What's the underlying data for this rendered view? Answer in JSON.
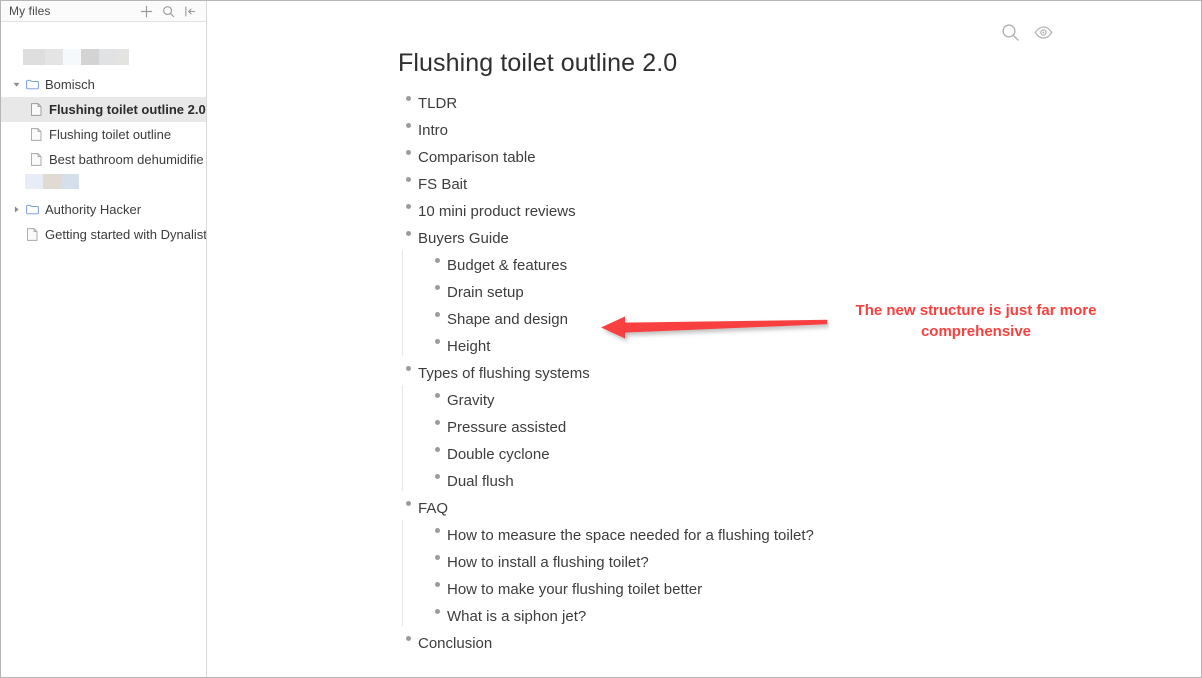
{
  "sidebar": {
    "title": "My files",
    "header_icons": [
      {
        "name": "add-icon",
        "label": "New"
      },
      {
        "name": "search-icon",
        "label": "Search"
      },
      {
        "name": "collapse-panel-icon",
        "label": "Collapse sidebar"
      }
    ],
    "items": [
      {
        "type": "redacted",
        "name": "redacted-item-1"
      },
      {
        "type": "folder",
        "label": "Bomisch",
        "expanded": true,
        "selected": false
      },
      {
        "type": "file",
        "label": "Flushing toilet outline 2.0",
        "selected": true
      },
      {
        "type": "file",
        "label": "Flushing toilet outline",
        "selected": false
      },
      {
        "type": "file",
        "label": "Best bathroom dehumidifie",
        "selected": false
      },
      {
        "type": "redacted",
        "name": "redacted-item-2"
      },
      {
        "type": "folder",
        "label": "Authority Hacker",
        "expanded": false,
        "selected": false
      },
      {
        "type": "root-file",
        "label": "Getting started with Dynalist",
        "selected": false
      }
    ]
  },
  "toolbar": {
    "icons": [
      {
        "name": "search-icon",
        "label": "Search document"
      },
      {
        "name": "eye-icon",
        "label": "Preview"
      }
    ]
  },
  "document": {
    "title": "Flushing toilet outline 2.0",
    "outline": [
      {
        "text": "TLDR"
      },
      {
        "text": "Intro"
      },
      {
        "text": "Comparison table"
      },
      {
        "text": "FS Bait"
      },
      {
        "text": "10 mini product reviews"
      },
      {
        "text": "Buyers Guide",
        "children": [
          {
            "text": "Budget & features"
          },
          {
            "text": "Drain setup"
          },
          {
            "text": "Shape and design"
          },
          {
            "text": "Height"
          }
        ]
      },
      {
        "text": "Types of flushing systems",
        "children": [
          {
            "text": "Gravity"
          },
          {
            "text": "Pressure assisted"
          },
          {
            "text": "Double cyclone"
          },
          {
            "text": "Dual flush"
          }
        ]
      },
      {
        "text": "FAQ",
        "children": [
          {
            "text": "How to measure the space needed for a flushing toilet?"
          },
          {
            "text": "How to install a flushing toilet?"
          },
          {
            "text": "How to make your flushing toilet better"
          },
          {
            "text": "What is a siphon jet?"
          }
        ]
      },
      {
        "text": "Conclusion"
      }
    ]
  },
  "annotation": {
    "text": "The new structure is just far more comprehensive",
    "color": "#f8413f",
    "arrow": {
      "name": "left-arrow",
      "direction": "left"
    }
  }
}
